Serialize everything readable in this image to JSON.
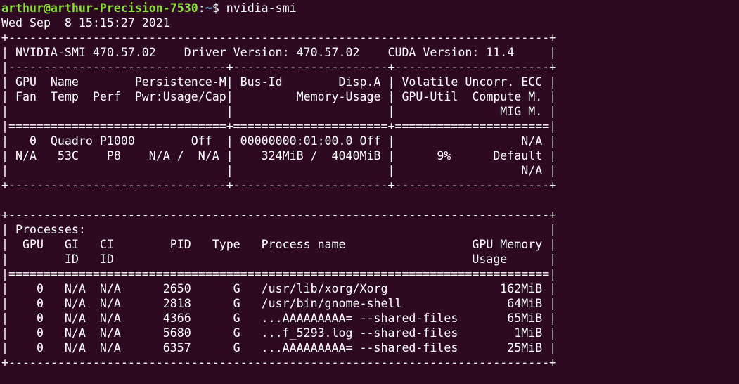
{
  "terminal": {
    "background_color": "#2d0922",
    "foreground_color": "#ffffff",
    "prompt_user_color": "#8ae234",
    "prompt_path_color": "#729fcf"
  },
  "prompt": {
    "user_host": "arthur@arthur-Precision-7530",
    "colon": ":",
    "path": "~",
    "dollar": "$",
    "command": " nvidia-smi"
  },
  "output": {
    "timestamp": "Wed Sep  8 15:15:27 2021",
    "lines": [
      "+-----------------------------------------------------------------------------+",
      "| NVIDIA-SMI 470.57.02    Driver Version: 470.57.02    CUDA Version: 11.4     |",
      "|-------------------------------+----------------------+----------------------+",
      "| GPU  Name        Persistence-M| Bus-Id        Disp.A | Volatile Uncorr. ECC |",
      "| Fan  Temp  Perf  Pwr:Usage/Cap|         Memory-Usage | GPU-Util  Compute M. |",
      "|                               |                      |               MIG M. |",
      "|===============================+======================+======================|",
      "|   0  Quadro P1000        Off  | 00000000:01:00.0 Off |                  N/A |",
      "| N/A   53C    P8    N/A /  N/A |    324MiB /  4040MiB |      9%      Default |",
      "|                               |                      |                  N/A |",
      "+-------------------------------+----------------------+----------------------+",
      "",
      "+-----------------------------------------------------------------------------+",
      "| Processes:                                                                  |",
      "|  GPU   GI   CI        PID   Type   Process name                  GPU Memory |",
      "|        ID   ID                                                   Usage      |",
      "|=============================================================================|",
      "|    0   N/A  N/A      2650      G   /usr/lib/xorg/Xorg                162MiB |",
      "|    0   N/A  N/A      2818      G   /usr/bin/gnome-shell               64MiB |",
      "|    0   N/A  N/A      4366      G   ...AAAAAAAAA= --shared-files       65MiB |",
      "|    0   N/A  N/A      5680      G   ...f_5293.log --shared-files        1MiB |",
      "|    0   N/A  N/A      6357      G   ...AAAAAAAAA= --shared-files       25MiB |",
      "+-----------------------------------------------------------------------------+"
    ],
    "smi_header": {
      "smi_version_label": "NVIDIA-SMI",
      "smi_version": "470.57.02",
      "driver_version_label": "Driver Version:",
      "driver_version": "470.57.02",
      "cuda_version_label": "CUDA Version:",
      "cuda_version": "11.4"
    },
    "gpu_table": {
      "columns_row1": [
        "GPU",
        "Name",
        "Persistence-M",
        "Bus-Id",
        "Disp.A",
        "Volatile Uncorr. ECC"
      ],
      "columns_row2": [
        "Fan",
        "Temp",
        "Perf",
        "Pwr:Usage/Cap",
        "Memory-Usage",
        "GPU-Util",
        "Compute M."
      ],
      "columns_row3": [
        "MIG M."
      ],
      "rows": [
        {
          "gpu": "0",
          "name": "Quadro P1000",
          "persistence_m": "Off",
          "bus_id": "00000000:01:00.0",
          "disp_a": "Off",
          "ecc": "N/A",
          "fan": "N/A",
          "temp": "53C",
          "perf": "P8",
          "pwr_usage_cap": "N/A /  N/A",
          "memory_usage": "324MiB /  4040MiB",
          "gpu_util": "9%",
          "compute_m": "Default",
          "mig_m": "N/A"
        }
      ]
    },
    "processes_table": {
      "section_title": "Processes:",
      "columns_row1": [
        "GPU",
        "GI",
        "CI",
        "PID",
        "Type",
        "Process name",
        "GPU Memory"
      ],
      "columns_row2": [
        "ID",
        "ID",
        "Usage"
      ],
      "rows": [
        {
          "gpu": "0",
          "gi_id": "N/A",
          "ci_id": "N/A",
          "pid": "2650",
          "type": "G",
          "process_name": "/usr/lib/xorg/Xorg",
          "gpu_memory_usage": "162MiB"
        },
        {
          "gpu": "0",
          "gi_id": "N/A",
          "ci_id": "N/A",
          "pid": "2818",
          "type": "G",
          "process_name": "/usr/bin/gnome-shell",
          "gpu_memory_usage": "64MiB"
        },
        {
          "gpu": "0",
          "gi_id": "N/A",
          "ci_id": "N/A",
          "pid": "4366",
          "type": "G",
          "process_name": "...AAAAAAAAA= --shared-files",
          "gpu_memory_usage": "65MiB"
        },
        {
          "gpu": "0",
          "gi_id": "N/A",
          "ci_id": "N/A",
          "pid": "5680",
          "type": "G",
          "process_name": "...f_5293.log --shared-files",
          "gpu_memory_usage": "1MiB"
        },
        {
          "gpu": "0",
          "gi_id": "N/A",
          "ci_id": "N/A",
          "pid": "6357",
          "type": "G",
          "process_name": "...AAAAAAAAA= --shared-files",
          "gpu_memory_usage": "25MiB"
        }
      ]
    }
  }
}
